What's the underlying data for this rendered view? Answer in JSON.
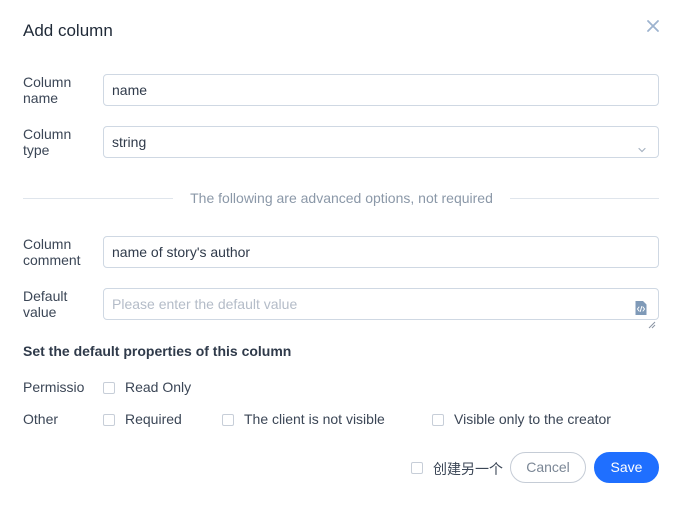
{
  "dialog": {
    "title": "Add column"
  },
  "fields": {
    "name": {
      "label": "Column name",
      "value": "name"
    },
    "type": {
      "label": "Column type",
      "value": "string"
    },
    "comment": {
      "label": "Column comment",
      "value": "name of story's author"
    },
    "default": {
      "label": "Default value",
      "placeholder": "Please enter the default value"
    }
  },
  "divider_text": "The following are advanced options, not required",
  "properties": {
    "heading": "Set the default properties of this column",
    "permission_label": "Permissio",
    "permission_options": [
      "Read Only"
    ],
    "other_label": "Other",
    "other_options": [
      "Required",
      "The client is not visible",
      "Visible only to the creator"
    ]
  },
  "footer": {
    "create_another_label": "创建另一个",
    "cancel_label": "Cancel",
    "save_label": "Save"
  },
  "colors": {
    "accent": "#1f6fff",
    "border": "#cfd8e3"
  },
  "icons": {
    "close": "close-icon",
    "select": "chevron-down-icon",
    "code": "code-file-icon"
  }
}
